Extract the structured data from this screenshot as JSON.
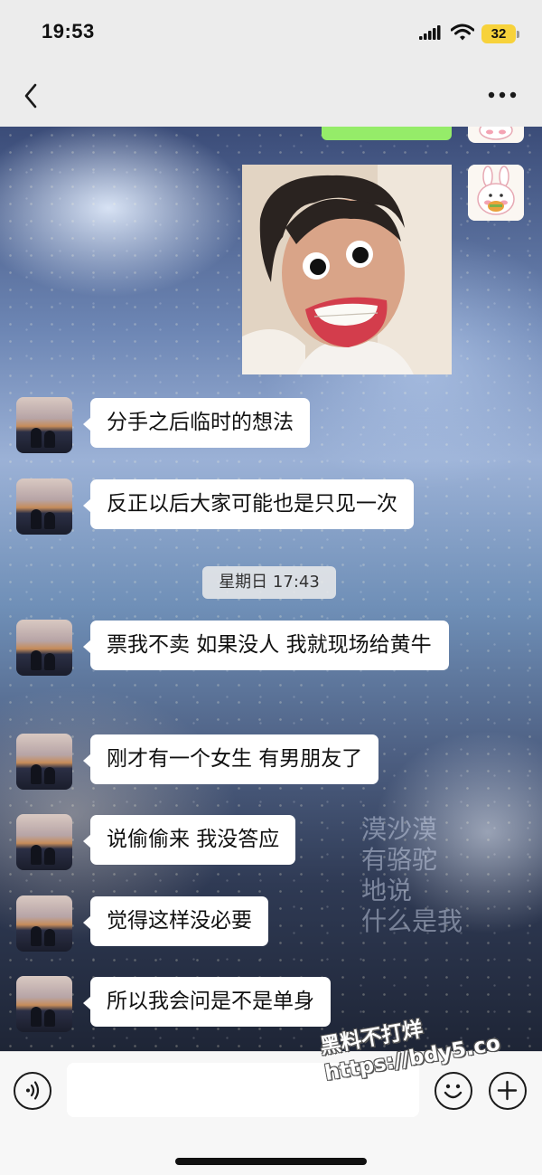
{
  "status_bar": {
    "time": "19:53",
    "battery": "32",
    "icons": [
      "signal-icon",
      "wifi-icon",
      "battery-icon"
    ]
  },
  "title_bar": {
    "back_icon": "chevron-left-icon",
    "more_icon": "more-dots-icon"
  },
  "chat": {
    "background_caption": [
      "漠沙漠",
      "有骆驼",
      "地说",
      "什么是我"
    ],
    "sent": [
      {
        "type": "image",
        "description_icon": "photo-message-icon"
      }
    ],
    "timestamp": "星期日 17:43",
    "received": [
      {
        "text": "分手之后临时的想法"
      },
      {
        "text": "反正以后大家可能也是只见一次"
      },
      {
        "text": "票我不卖 如果没人 我就现场给黄牛"
      },
      {
        "text": "刚才有一个女生 有男朋友了"
      },
      {
        "text": "说偷偷来 我没答应"
      },
      {
        "text": "觉得这样没必要"
      },
      {
        "text": "所以我会问是不是单身"
      }
    ]
  },
  "input_bar": {
    "input_value": "",
    "icons": [
      "voice-icon",
      "emoji-icon",
      "plus-icon"
    ]
  },
  "watermark": {
    "line1": "黑料不打烊",
    "line2": "https://bdy5.co"
  },
  "colors": {
    "bubble_received": "#ffffff",
    "bubble_sent": "#95ec69",
    "battery": "#f7d23b",
    "top_bar": "#ececec"
  }
}
